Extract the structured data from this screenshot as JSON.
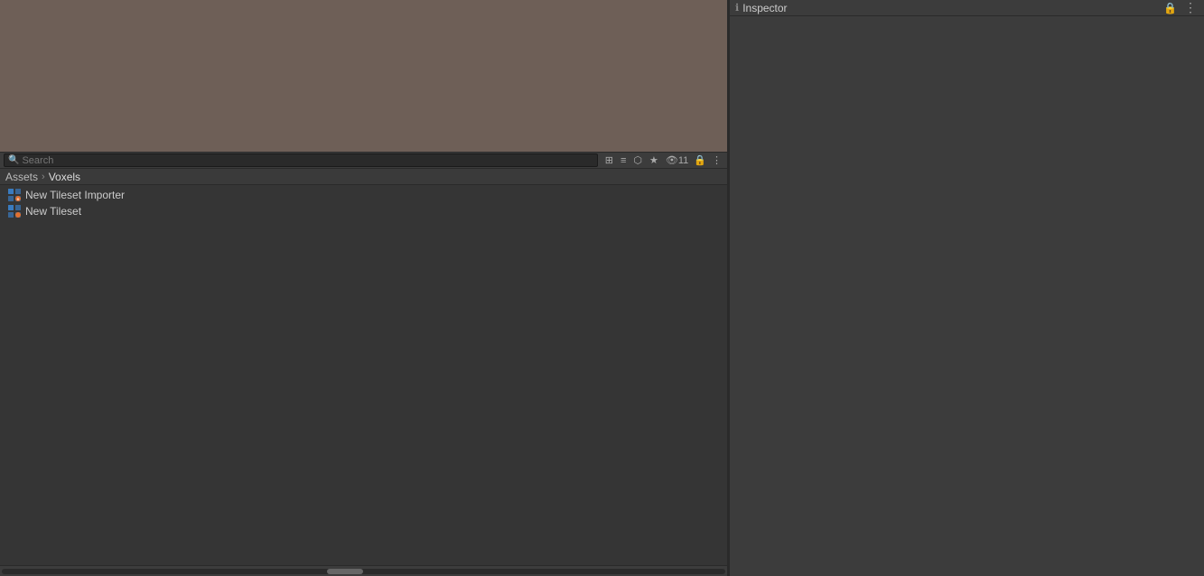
{
  "left_panel": {
    "scene_bg_color": "#6e5f57",
    "toolbar": {
      "search_placeholder": "Search",
      "lock_icon": "🔒",
      "more_icon": "⋮",
      "btn_grid": "⊞",
      "btn_list": "≡",
      "btn_filter": "⬡",
      "btn_star": "★",
      "btn_eye": "👁",
      "count_label": "11"
    },
    "breadcrumb": {
      "root": "Assets",
      "separator": "›",
      "current": "Voxels"
    },
    "files": [
      {
        "name": "New Tileset Importer",
        "icon_type": "tileset"
      },
      {
        "name": "New Tileset",
        "icon_type": "tileset"
      }
    ],
    "scrollbar": {
      "thumb_left_pct": 45
    }
  },
  "inspector": {
    "title": "Inspector",
    "info_icon": "ℹ",
    "lock_icon": "🔒",
    "menu_icon": "⋮"
  }
}
